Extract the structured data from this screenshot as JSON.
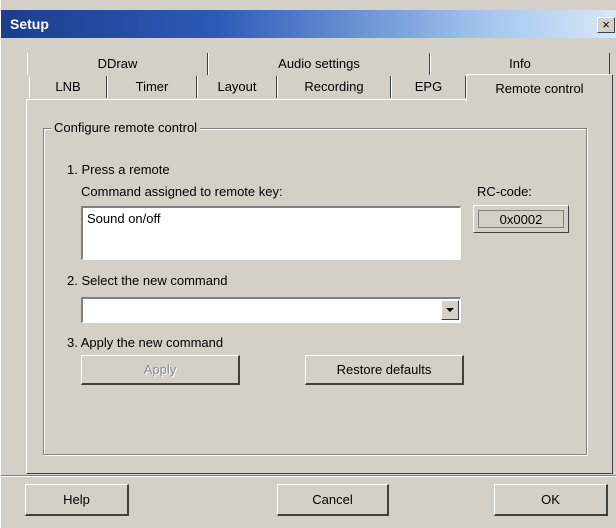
{
  "window": {
    "title": "Setup",
    "close_label": "×"
  },
  "tabs": {
    "back_row": [
      "DDraw",
      "Audio settings",
      "Info"
    ],
    "front_row": [
      "LNB",
      "Timer",
      "Layout",
      "Recording",
      "EPG",
      "Remote control"
    ],
    "active": "Remote control"
  },
  "group": {
    "title": "Configure remote control",
    "step1_label": "1. Press a remote",
    "command_label": "Command assigned to remote key:",
    "command_value": "Sound on/off",
    "rc_code_label": "RC-code:",
    "rc_code_value": "0x0002",
    "step2_label": "2. Select the new command",
    "select_value": "",
    "step3_label": "3. Apply the new command",
    "apply_label": "Apply",
    "restore_label": "Restore defaults"
  },
  "footer": {
    "help_label": "Help",
    "cancel_label": "Cancel",
    "ok_label": "OK"
  }
}
